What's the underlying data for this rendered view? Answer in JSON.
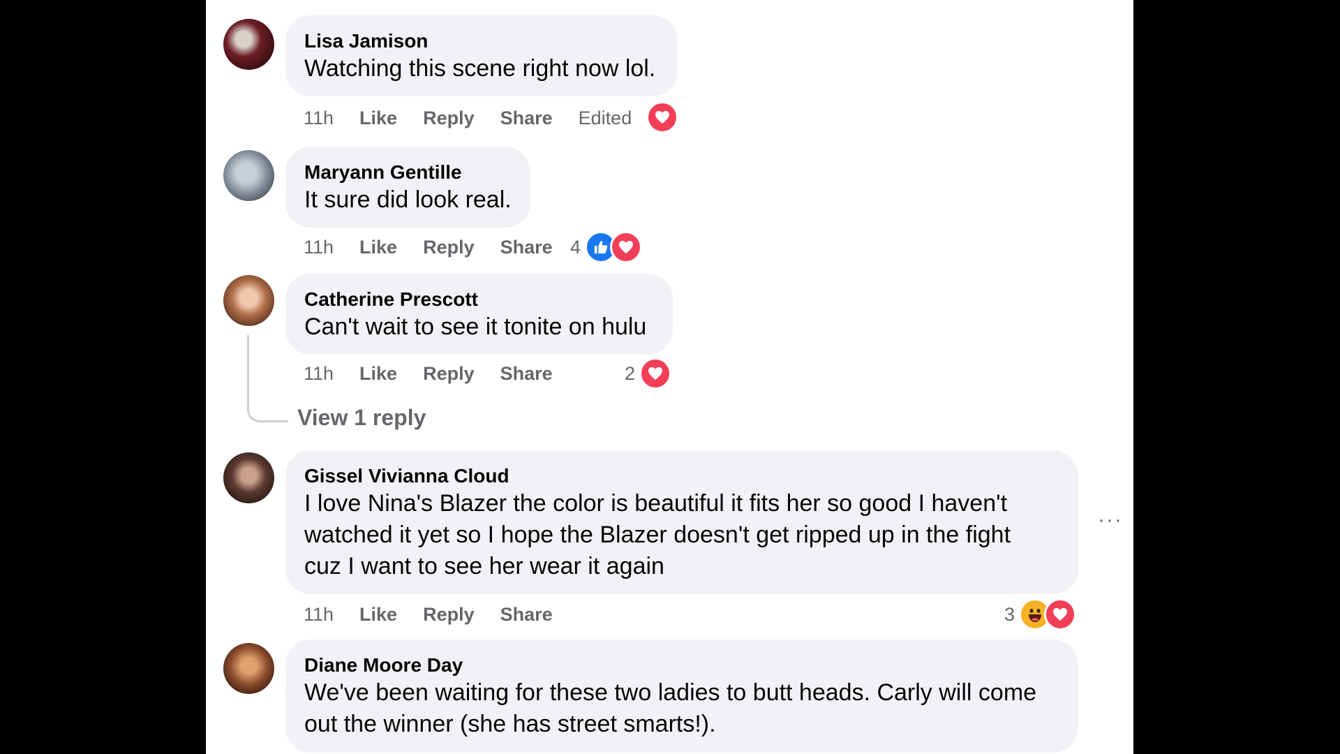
{
  "comments": [
    {
      "author": "Lisa Jamison",
      "text": [
        "Watching this scene right now lol."
      ],
      "time": "11h",
      "like": "Like",
      "reply": "Reply",
      "share": "Share",
      "edited": "Edited",
      "reaction_count": "",
      "reactions": [
        "love"
      ]
    },
    {
      "author": "Maryann Gentille",
      "text": [
        "It sure did look real."
      ],
      "time": "11h",
      "like": "Like",
      "reply": "Reply",
      "share": "Share",
      "reaction_count": "4",
      "reactions": [
        "like",
        "love"
      ]
    },
    {
      "author": "Catherine Prescott",
      "text": [
        "Can't wait to see it tonite on hulu"
      ],
      "time": "11h",
      "like": "Like",
      "reply": "Reply",
      "share": "Share",
      "reaction_count": "2",
      "reactions": [
        "love"
      ],
      "view_replies": "View 1 reply"
    },
    {
      "author": "Gissel Vivianna Cloud",
      "text": [
        "I love Nina's Blazer the color is beautiful it fits her so good I haven't",
        "watched it yet so I hope the Blazer doesn't get ripped up in the fight",
        "cuz I want to see her wear it again"
      ],
      "time": "11h",
      "like": "Like",
      "reply": "Reply",
      "share": "Share",
      "reaction_count": "3",
      "reactions": [
        "haha",
        "love"
      ],
      "more": "···"
    },
    {
      "author": "Diane Moore Day",
      "text": [
        "We've been waiting for these two ladies to butt heads. Carly will come",
        "out the winner (she has street smarts!)."
      ]
    }
  ],
  "colors": {
    "bubble": "#f0f2f5",
    "meta": "#65676b",
    "love": "#f33e58",
    "like": "#1877f2",
    "haha": "#f7b125"
  }
}
